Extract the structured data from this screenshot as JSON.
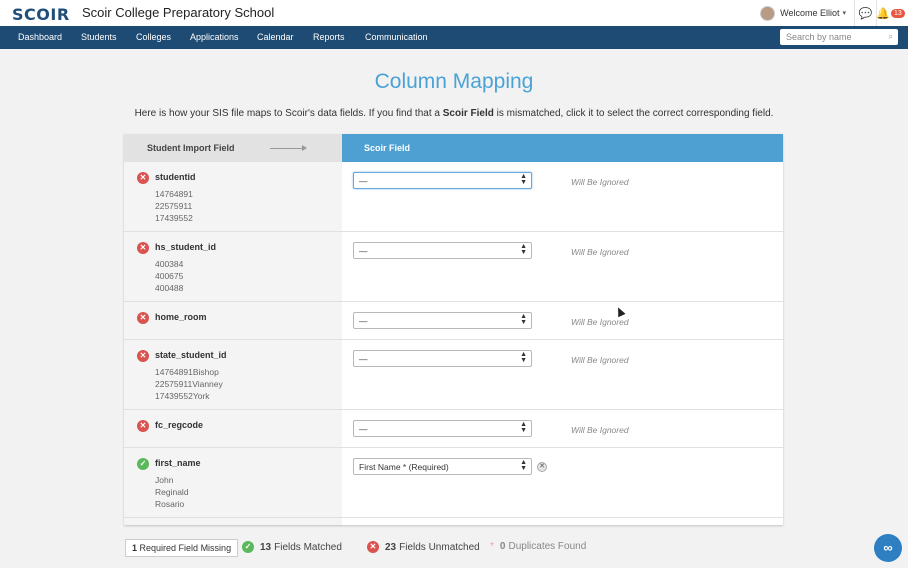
{
  "header": {
    "logo": "SCOIR",
    "school": "Scoir College Preparatory School",
    "welcome": "Welcome Elliot",
    "notifications_count": "13"
  },
  "nav": {
    "items": [
      "Dashboard",
      "Students",
      "Colleges",
      "Applications",
      "Calendar",
      "Reports",
      "Communication"
    ],
    "search_placeholder": "Search by name"
  },
  "page": {
    "title": "Column Mapping",
    "subtitle_pre": "Here is how your SIS file maps to Scoir's data fields. If you find that a ",
    "subtitle_bold": "Scoir Field",
    "subtitle_post": " is mismatched, click it to select the correct corresponding field."
  },
  "table": {
    "left_header": "Student Import Field",
    "right_header": "Scoir Field",
    "rows": [
      {
        "status": "unmatched",
        "field": "studentid",
        "samples": [
          "14764891",
          "22575911",
          "17439552"
        ],
        "select": "—",
        "note": "Will Be Ignored"
      },
      {
        "status": "unmatched",
        "field": "hs_student_id",
        "samples": [
          "400384",
          "400675",
          "400488"
        ],
        "select": "—",
        "note": "Will Be Ignored"
      },
      {
        "status": "unmatched",
        "field": "home_room",
        "samples": [],
        "select": "—",
        "note": "Will Be Ignored"
      },
      {
        "status": "unmatched",
        "field": "state_student_id",
        "samples": [
          "14764891Bishop",
          "22575911Vianney",
          "17439552York"
        ],
        "select": "—",
        "note": "Will Be Ignored"
      },
      {
        "status": "unmatched",
        "field": "fc_regcode",
        "samples": [],
        "select": "—",
        "note": "Will Be Ignored"
      },
      {
        "status": "matched",
        "field": "first_name",
        "samples": [
          "John",
          "Reginald",
          "Rosario"
        ],
        "select": "First Name * (Required)",
        "note": ""
      }
    ]
  },
  "summary": {
    "missing_count": "1",
    "missing_label": "Required Field Missing",
    "matched_count": "13",
    "matched_label": "Fields Matched",
    "unmatched_count": "23",
    "unmatched_label": "Fields Unmatched",
    "dup_count": "0",
    "dup_label": "Duplicates Found"
  },
  "colors": {
    "brand_navy": "#1e4b73",
    "accent_blue": "#4ea0d3",
    "error_red": "#d9534f",
    "success_green": "#5cb85c"
  }
}
